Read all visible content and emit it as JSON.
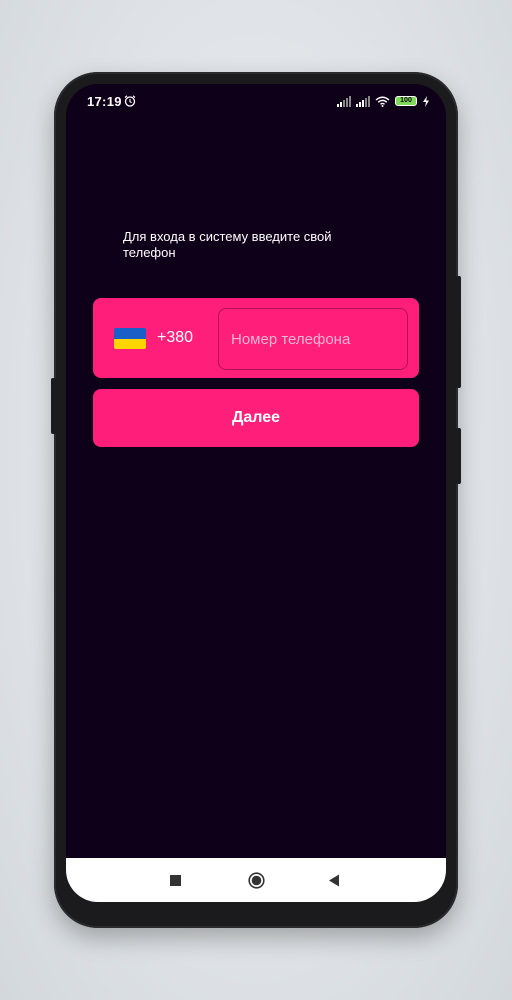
{
  "status_bar": {
    "time": "17:19",
    "battery": "100",
    "icons": [
      "alarm-icon",
      "signal-icon",
      "signal-icon",
      "wifi-icon",
      "battery-icon",
      "bolt-icon"
    ]
  },
  "login": {
    "prompt": "Для входа в систему введите свой телефон",
    "country_code": "+380",
    "country_flag": "ukraine-flag-icon",
    "phone_placeholder": "Номер телефона",
    "phone_value": "",
    "next_label": "Далее"
  },
  "nav_bar": {
    "icons": [
      "recent-apps-icon",
      "home-icon",
      "back-icon"
    ]
  },
  "colors": {
    "background": "#0f001a",
    "accent": "#ff1f7a",
    "text": "#ffffff",
    "flag_blue": "#1a5fc8",
    "flag_yellow": "#ffd500"
  }
}
